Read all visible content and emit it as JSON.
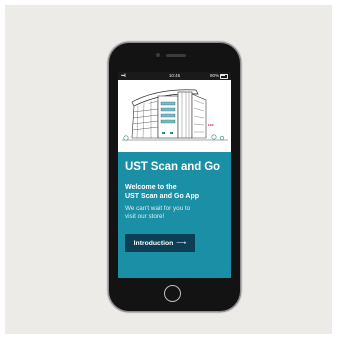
{
  "status_bar": {
    "signal": "•••ll",
    "time": "10:45",
    "battery": "80%"
  },
  "illustration": {
    "name": "stadium-building-illustration"
  },
  "screen": {
    "headline": "UST Scan and Go",
    "welcome_line1": "Welcome to the",
    "welcome_line2": "UST Scan and Go App",
    "description_line1": "We can't wait for you to",
    "description_line2": "visit our store!",
    "intro_button_label": "Introduction",
    "intro_button_arrow": "⟶"
  },
  "colors": {
    "panel": "#1a8fa5",
    "button": "#0c3f55",
    "background": "#ecebe7",
    "phone_body": "#131313"
  }
}
